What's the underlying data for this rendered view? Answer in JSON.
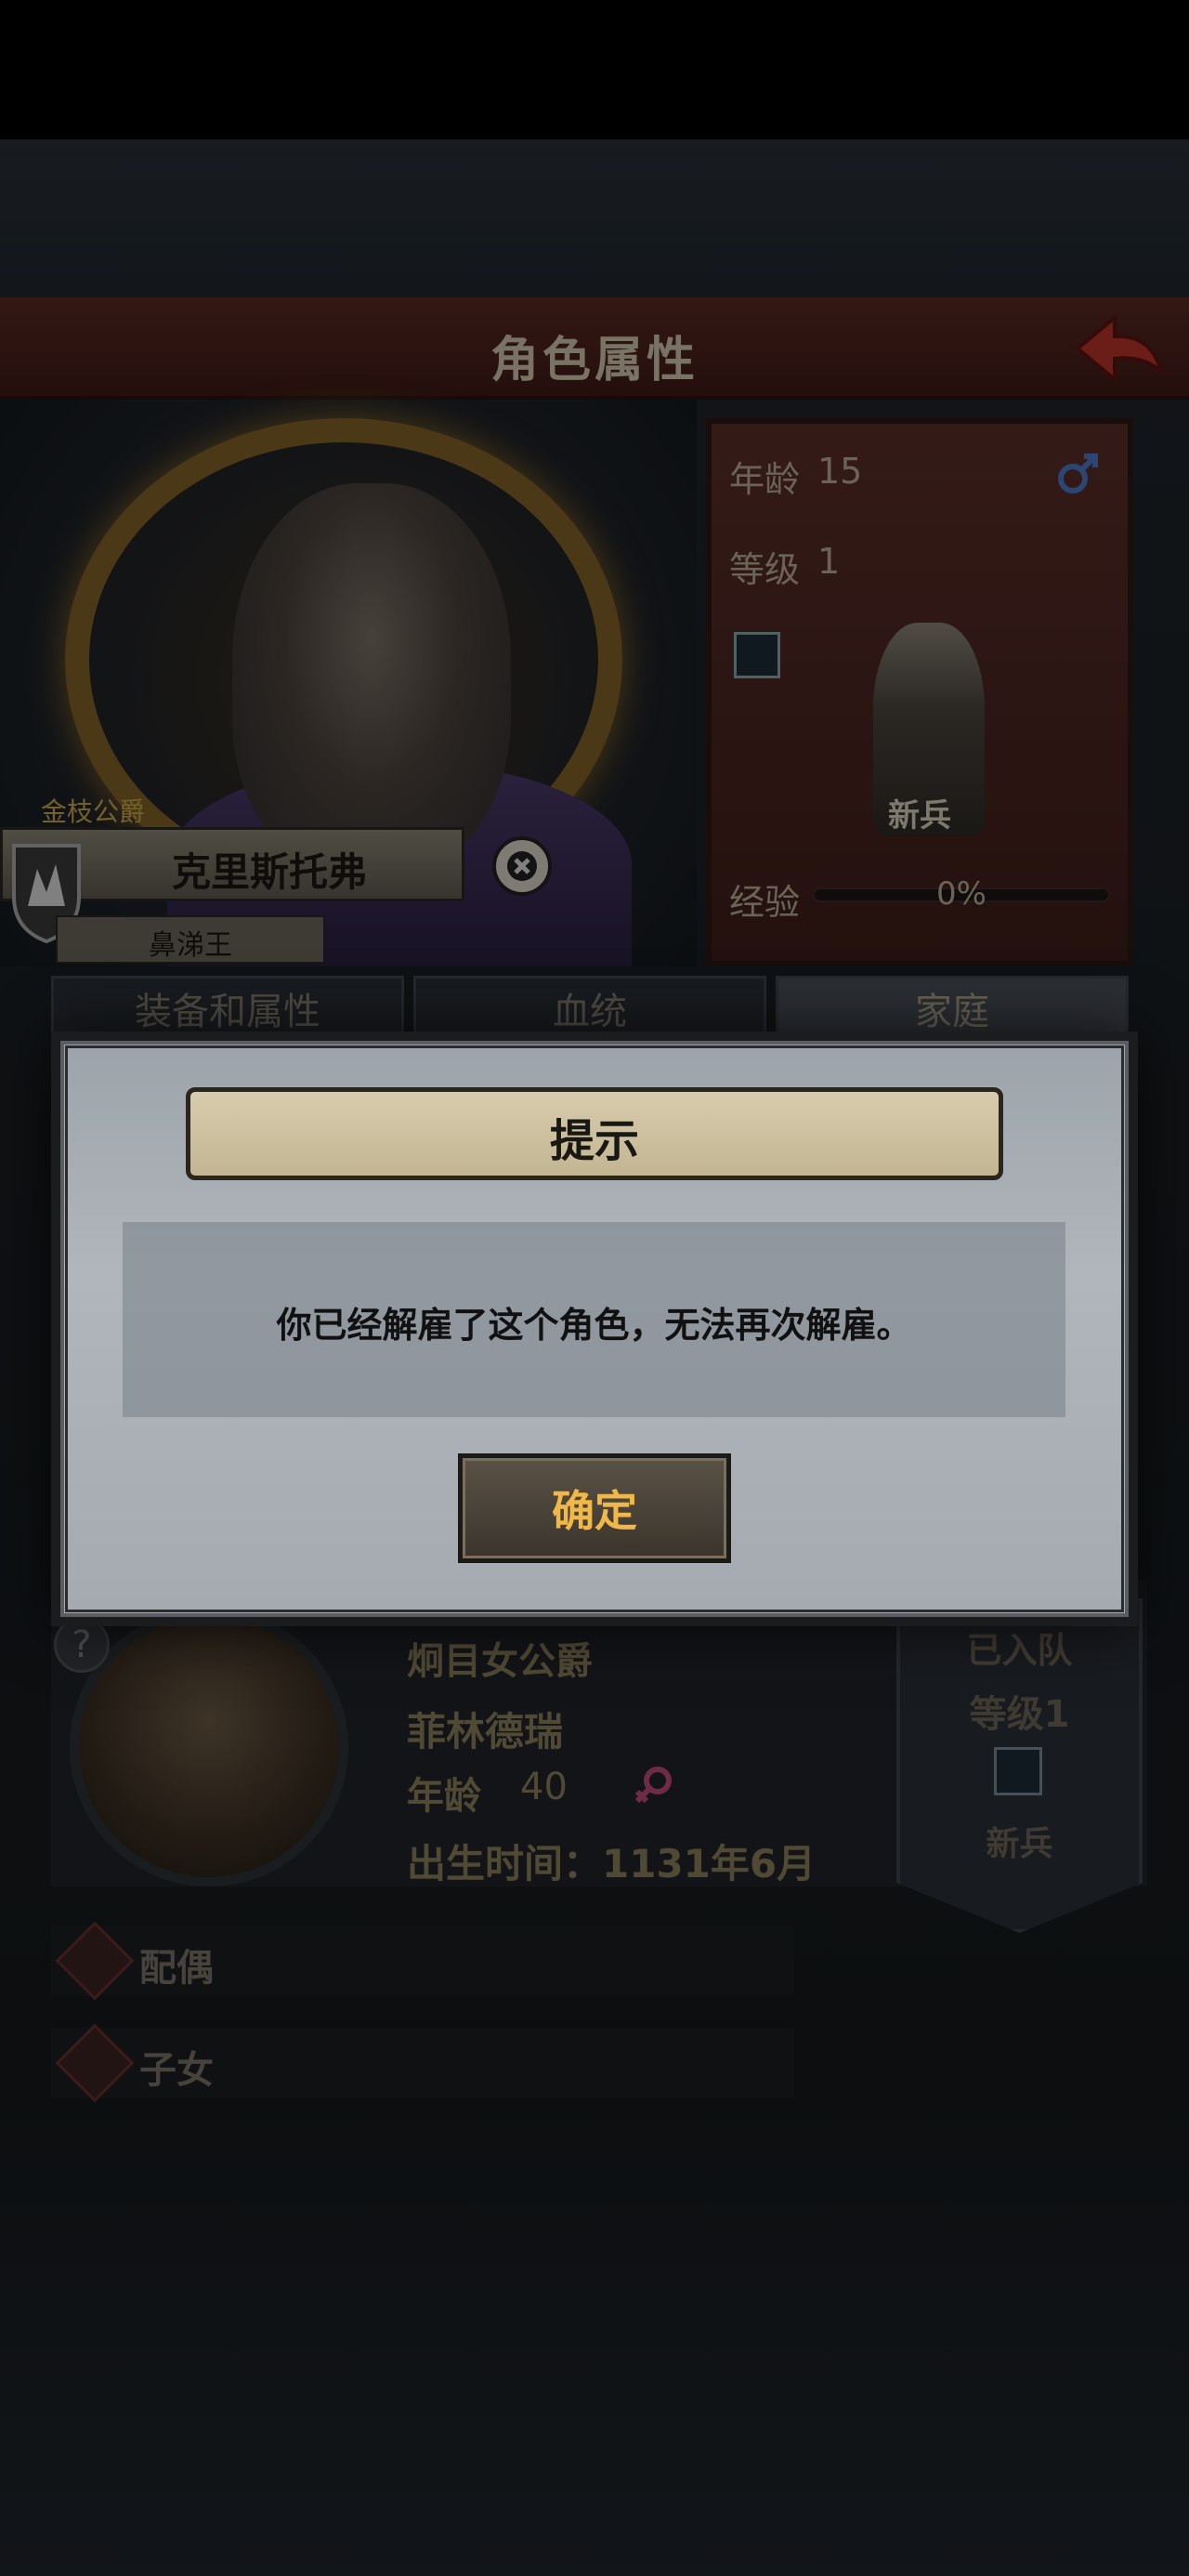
{
  "screen": {
    "title": "角色属性"
  },
  "character": {
    "rank": "金枝公爵",
    "name": "克里斯托弗",
    "subtitle": "鼻涕王",
    "stats": {
      "age_label": "年龄",
      "age_value": "15",
      "level_label": "等级",
      "level_value": "1",
      "class_name": "新兵",
      "exp_label": "经验",
      "exp_text": "0%",
      "exp_fraction": 0
    }
  },
  "tabs": [
    {
      "label": "装备和属性",
      "active": false
    },
    {
      "label": "血统",
      "active": false
    },
    {
      "label": "家庭",
      "active": true
    }
  ],
  "family": {
    "spouse": {
      "title": "炯目女公爵",
      "name": "菲林德瑞",
      "age_label": "年龄",
      "age_value": "40",
      "birth": "出生时间：1131年6月",
      "status": "已入队",
      "level": "等级1",
      "class_name": "新兵"
    },
    "relations": [
      {
        "label": "配偶",
        "icon": "heart-icon"
      },
      {
        "label": "子女",
        "icon": "person-icon"
      }
    ]
  },
  "dialog": {
    "title": "提示",
    "message": "你已经解雇了这个角色，无法再次解雇。",
    "confirm_label": "确定"
  },
  "colors": {
    "accent_gold": "#f0b84a",
    "title_bar_red": "#5a2a22",
    "dialog_bg": "#b0b6bb"
  }
}
